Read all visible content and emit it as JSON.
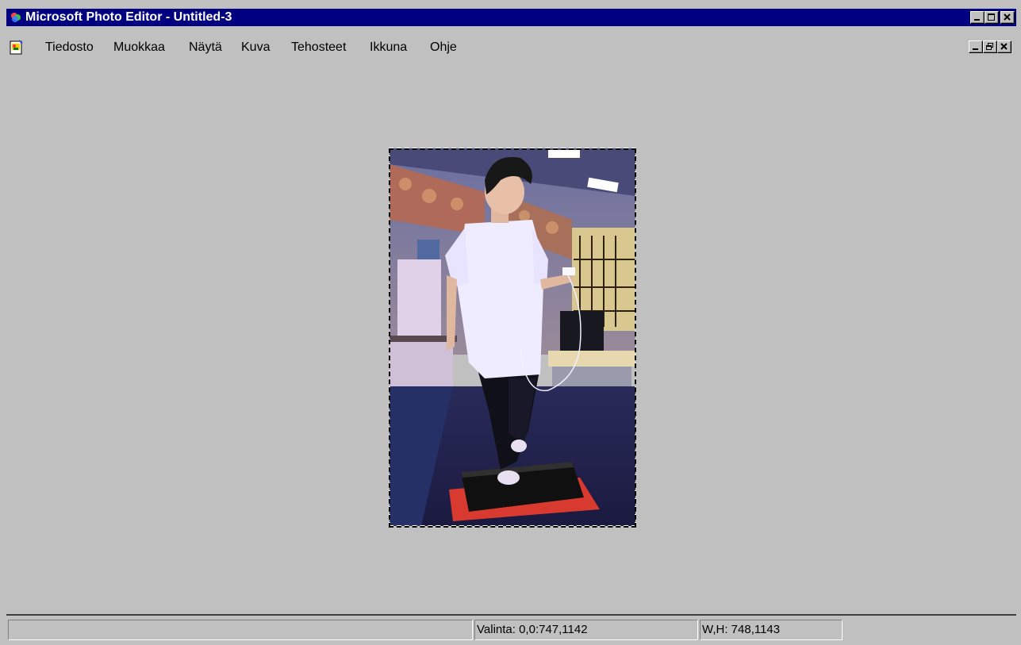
{
  "window": {
    "title": "Microsoft Photo Editor - Untitled-3"
  },
  "menu": {
    "items": [
      {
        "label": "Tiedosto"
      },
      {
        "label": "Muokkaa"
      },
      {
        "label": "Näytä"
      },
      {
        "label": "Kuva"
      },
      {
        "label": "Tehosteet"
      },
      {
        "label": "Ikkuna"
      },
      {
        "label": "Ohje"
      }
    ]
  },
  "image": {
    "description_icon": "photo-image"
  },
  "status": {
    "message": "",
    "selection": "Valinta: 0,0:747,1142",
    "size": "W,H: 748,1143"
  },
  "colors": {
    "title_bar": "#000080",
    "face": "#c0c0c0"
  }
}
